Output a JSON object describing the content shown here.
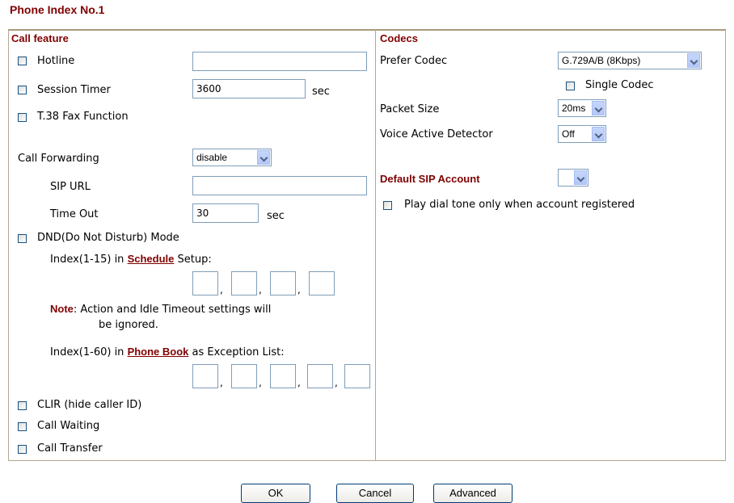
{
  "page_title": "Phone Index No.1",
  "call_feature": {
    "heading": "Call feature",
    "hotline": {
      "label": "Hotline",
      "value": "",
      "checked": false
    },
    "session_timer": {
      "label": "Session Timer",
      "value": "3600",
      "unit": "sec",
      "checked": false
    },
    "t38": {
      "label": "T.38 Fax Function",
      "checked": false
    },
    "call_forwarding": {
      "label": "Call Forwarding",
      "value": "disable"
    },
    "sip_url": {
      "label": "SIP URL",
      "value": ""
    },
    "time_out": {
      "label": "Time Out",
      "value": "30",
      "unit": "sec"
    },
    "dnd": {
      "label": "DND(Do Not Disturb) Mode",
      "checked": false
    },
    "schedule_prefix": "Index(1-15) in ",
    "schedule_link": "Schedule",
    "schedule_suffix": " Setup:",
    "schedule_sep": ",",
    "note_label": "Note",
    "note_text": ":  Action and Idle Timeout settings will",
    "note_text2": "be ignored.",
    "phonebook_prefix": "Index(1-60) in ",
    "phonebook_link": "Phone Book",
    "phonebook_suffix": " as Exception List:",
    "clir": {
      "label": "CLIR (hide caller ID)",
      "checked": false
    },
    "call_waiting": {
      "label": "Call Waiting",
      "checked": false
    },
    "call_transfer": {
      "label": "Call Transfer",
      "checked": false
    }
  },
  "codecs": {
    "heading": "Codecs",
    "prefer_codec": {
      "label": "Prefer Codec",
      "value": "G.729A/B (8Kbps)"
    },
    "single_codec": {
      "label": "Single Codec",
      "checked": false
    },
    "packet_size": {
      "label": "Packet Size",
      "value": "20ms"
    },
    "vad": {
      "label": "Voice Active Detector",
      "value": "Off"
    }
  },
  "default_sip": {
    "heading": "Default SIP Account",
    "value": "",
    "play_dial_tone": {
      "label": "Play dial tone only when account registered",
      "checked": false
    }
  },
  "buttons": {
    "ok": "OK",
    "cancel": "Cancel",
    "advanced": "Advanced"
  },
  "colors": {
    "accent": "#800000",
    "input_border": "#7f9db9",
    "frame": "#b0a890"
  }
}
